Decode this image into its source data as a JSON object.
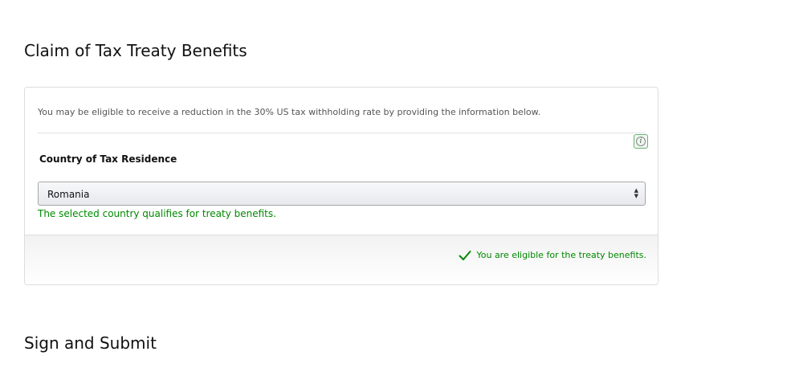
{
  "header": {
    "title": "Claim of Tax Treaty Benefits"
  },
  "treaty_card": {
    "intro_text": "You may be eligible to receive a reduction in the 30% US tax withholding rate by providing the information below.",
    "info_icon": "info-icon",
    "country_field": {
      "label": "Country of Tax Residence",
      "selected_value": "Romania"
    },
    "status_message": "The selected country qualifies for treaty benefits.",
    "footer": {
      "eligibility_text": "You are eligible for the treaty benefits.",
      "icon": "checkmark-icon"
    }
  },
  "next_section": {
    "title": "Sign and Submit"
  },
  "colors": {
    "success": "#008a00",
    "border": "#dddddd",
    "text": "#111111"
  }
}
